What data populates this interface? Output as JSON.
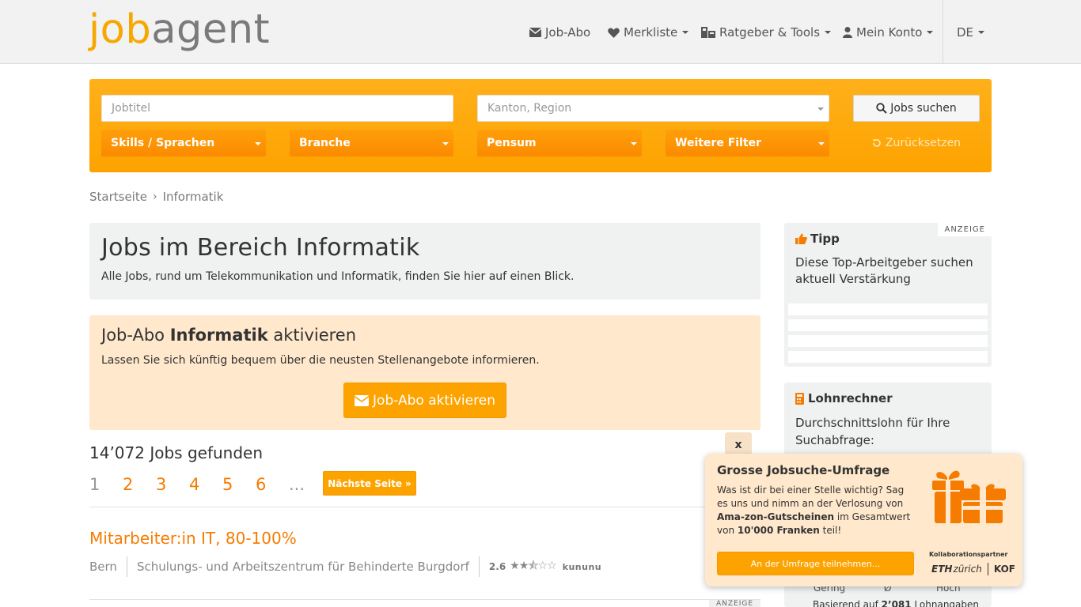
{
  "header": {
    "logo_job": "job",
    "logo_agent": "agent",
    "nav": {
      "job_abo": "Job-Abo",
      "merkliste": "Merkliste",
      "ratgeber": "Ratgeber & Tools",
      "konto": "Mein Konto",
      "lang": "DE"
    }
  },
  "search": {
    "jobtitel_placeholder": "Jobtitel",
    "region_placeholder": "Kanton, Region",
    "search_button": "Jobs suchen",
    "filters": [
      "Skills / Sprachen",
      "Branche",
      "Pensum",
      "Weitere Filter"
    ],
    "reset": "Zurücksetzen"
  },
  "breadcrumb": {
    "home": "Startseite",
    "current": "Informatik"
  },
  "intro": {
    "title": "Jobs im Bereich Informatik",
    "text": "Alle Jobs, rund um Telekommunikation und Informatik, finden Sie hier auf einen Blick."
  },
  "abo": {
    "title_pre": "Job-Abo ",
    "title_bold": "Informatik",
    "title_post": " aktivieren",
    "text": "Lassen Sie sich künftig bequem über die neusten Stellenangebote informieren.",
    "button": "Job-Abo aktivieren"
  },
  "results": {
    "count": "14’072 Jobs gefunden",
    "pages": [
      "1",
      "2",
      "3",
      "4",
      "5",
      "6",
      "..."
    ],
    "next": "Nächste Seite"
  },
  "job": {
    "title": "Mitarbeiter:in IT, 80-100%",
    "location": "Bern",
    "company": "Schulungs- und Arbeitszentrum für Behinderte Burgdorf",
    "rating": "2.6",
    "rating_stars": 2.6,
    "rating_source": "kununu",
    "ad_label": "ANZEIGE"
  },
  "sidebar": {
    "tip": {
      "title": "Tipp",
      "text": "Diese Top-Arbeitgeber suchen aktuell Verstärkung",
      "ad_label": "ANZEIGE"
    },
    "lohn": {
      "title": "Lohnrechner",
      "text": "Durchschnittslohn für Ihre Suchabfrage:",
      "low": "Gering",
      "avg": "Ø",
      "high": "Hoch",
      "basis_pre": "Basierend auf ",
      "basis_count": "2’081",
      "basis_post": " Lohnangaben"
    }
  },
  "popup": {
    "close": "x",
    "title": "Grosse Jobsuche-Umfrage",
    "text_1": "Was ist dir bei einer Stelle wichtig? Sag es uns und nimm an der Verlosung von ",
    "text_bold_1": "Ama-zon-Gutscheinen",
    "text_2": " im Gesamtwert von ",
    "text_bold_2": "10'000 Franken",
    "text_3": " teil!",
    "button": "An der Umfrage teilnehmen...",
    "collab": "Kollaborationspartner",
    "eth": "ETH",
    "eth_suffix": "zürich",
    "kof": "KOF"
  },
  "colors": {
    "accent": "#fda300",
    "link_orange": "#f57c00",
    "popup_bg": "#ffe8cc"
  }
}
